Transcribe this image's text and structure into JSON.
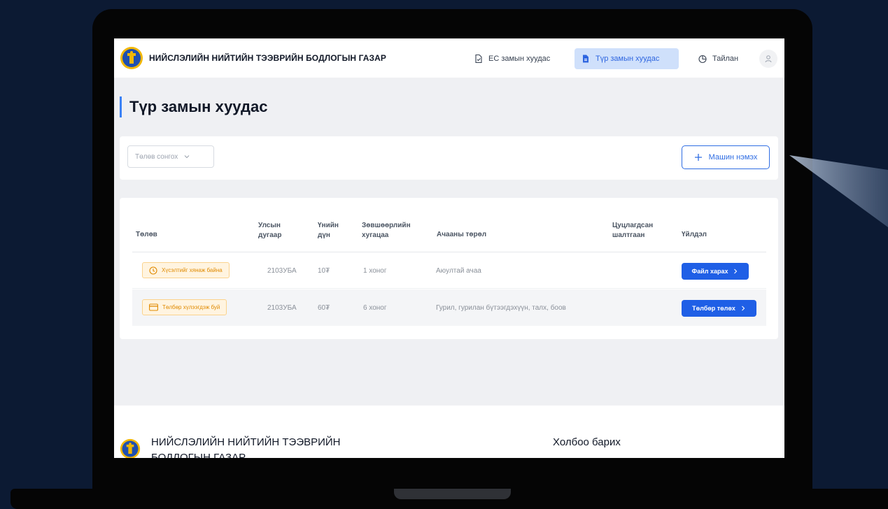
{
  "header": {
    "brand": "НИЙСЛЭЛИЙН НИЙТИЙН ТЭЭВРИЙН БОДЛОГЫН ГАЗАР",
    "nav": [
      {
        "label": "ЕС замын хуудас",
        "icon": "document-check-icon",
        "active": false
      },
      {
        "label": "Түр замын хуудас",
        "icon": "document-icon",
        "active": true
      },
      {
        "label": "Тайлан",
        "icon": "chart-pie-icon",
        "active": false
      }
    ],
    "avatar_icon": "user-icon"
  },
  "page": {
    "title": "Түр замын хуудас"
  },
  "filter": {
    "select_placeholder": "Төлөв сонгох",
    "add_button": "Машин нэмэх"
  },
  "table": {
    "columns": [
      "Төлөв",
      "Улсын дугаар",
      "Үнийн дүн",
      "Зөвшөөрлийн хугацаа",
      "Ачааны төрөл",
      "Цуцлагдсан шалтгаан",
      "Үйлдэл"
    ],
    "rows": [
      {
        "status": "Хүсэлтийг хянаж байна",
        "status_icon": "clock-icon",
        "plate": "2103УБА",
        "price": "10₮",
        "duration": "1 хоног",
        "cargo": "Аюултай ачаа",
        "cancel_reason": "",
        "action": "Файл харах"
      },
      {
        "status": "Төлбөр хүлээгдэж буй",
        "status_icon": "credit-card-icon",
        "plate": "2103УБА",
        "price": "60₮",
        "duration": "6 хоног",
        "cargo": "Гурил, гурилан бүтээгдэхүүн, талх, боов",
        "cancel_reason": "",
        "action": "Төлбөр төлөх"
      }
    ]
  },
  "footer": {
    "org": "НИЙСЛЭЛИЙН НИЙТИЙН ТЭЭВРИЙН БОДЛОГЫН ГАЗАР",
    "contact_title": "Холбоо барих"
  },
  "colors": {
    "background": "#0c1a33",
    "primary": "#1f5fe6",
    "active_nav_bg": "#cfe0fb",
    "warning": "#e08a00",
    "warning_bg": "#fff4e0"
  }
}
